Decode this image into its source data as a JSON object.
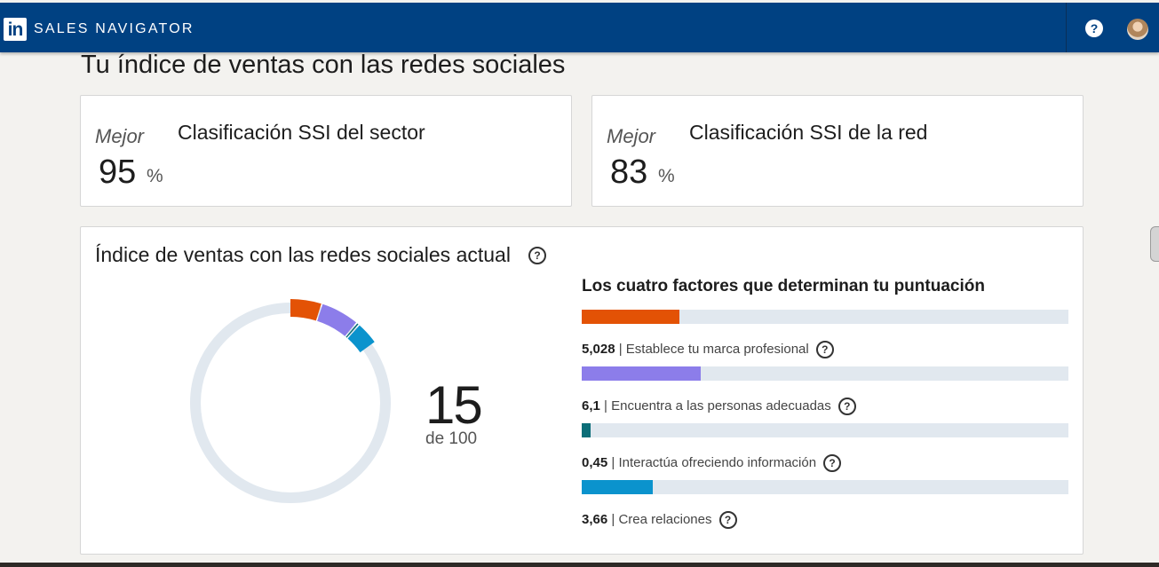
{
  "header": {
    "logo_text": "in",
    "brand": "SALES NAVIGATOR",
    "help_glyph": "?",
    "icons": [
      "help-icon",
      "avatar"
    ]
  },
  "page": {
    "title": "Tu índice de ventas con las redes sociales"
  },
  "rank_cards": [
    {
      "qualifier": "Mejor",
      "title": "Clasificación SSI del sector",
      "value": "95",
      "unit": "%"
    },
    {
      "qualifier": "Mejor",
      "title": "Clasificación SSI de la red",
      "value": "83",
      "unit": "%"
    }
  ],
  "ssi": {
    "title": "Índice de ventas con las redes sociales actual",
    "info_glyph": "?",
    "score": "15",
    "score_sub": "de 100",
    "score_value": 15,
    "score_max": 100,
    "factors_title": "Los cuatro factores que determinan tu puntuación",
    "track_color": "#e1e8ef",
    "factors": [
      {
        "value_text": "5,028",
        "label": "Establece tu marca profesional",
        "value": 5.028,
        "max": 25,
        "color": "#e35205"
      },
      {
        "value_text": "6,1",
        "label": "Encuentra a las personas adecuadas",
        "value": 6.1,
        "max": 25,
        "color": "#8c7dea"
      },
      {
        "value_text": "0,45",
        "label": "Interactúa ofreciendo información",
        "value": 0.45,
        "max": 25,
        "color": "#0c6e78"
      },
      {
        "value_text": "3,66",
        "label": "Crea relaciones",
        "value": 3.66,
        "max": 25,
        "color": "#0b93cd"
      }
    ]
  },
  "colors": {
    "brand": "#004182",
    "background": "#f3f2ef"
  }
}
